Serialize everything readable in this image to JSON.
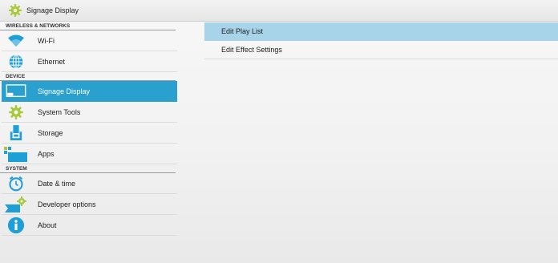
{
  "window": {
    "title": "Signage Display",
    "app_icon": "gear-icon"
  },
  "sidebar": {
    "categories": [
      {
        "label": "WIRELESS & NETWORKS"
      },
      {
        "label": "DEVICE"
      },
      {
        "label": "SYSTEM"
      }
    ],
    "items": [
      {
        "label": "Wi-Fi",
        "icon": "wifi-icon"
      },
      {
        "label": "Ethernet",
        "icon": "ethernet-icon"
      },
      {
        "label": "Signage Display",
        "icon": "display-icon",
        "selected": true
      },
      {
        "label": "System Tools",
        "icon": "gear-icon"
      },
      {
        "label": "Storage",
        "icon": "storage-icon"
      },
      {
        "label": "Apps",
        "icon": "apps-icon"
      },
      {
        "label": "Date & time",
        "icon": "clock-icon"
      },
      {
        "label": "Developer options",
        "icon": "developer-icon"
      },
      {
        "label": "About",
        "icon": "info-icon"
      }
    ]
  },
  "main": {
    "rows": [
      {
        "label": "Edit Play List",
        "selected": true
      },
      {
        "label": "Edit Effect Settings"
      }
    ]
  },
  "colors": {
    "selected_bg": "#2aa0cf",
    "row_selected_bg": "#a7d4e9",
    "icon_blue": "#1ea0d6"
  }
}
